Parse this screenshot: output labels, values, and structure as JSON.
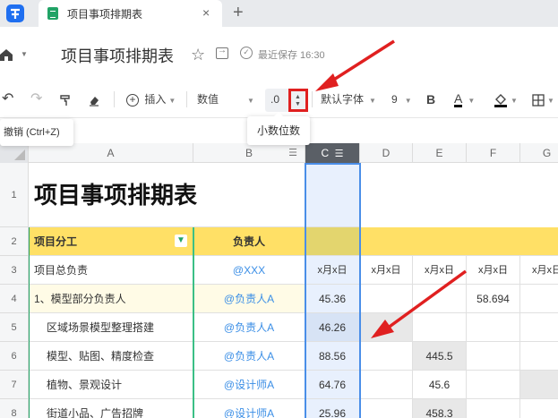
{
  "tabs": {
    "active_title": "项目事项排期表",
    "close": "×",
    "new": "+"
  },
  "header": {
    "doc_title": "项目事项排期表",
    "saved_status": "最近保存 16:30"
  },
  "toolbar": {
    "insert_label": "插入",
    "number_format": "数值",
    "decimal_value": ".0",
    "font_family": "默认字体",
    "font_size": "9",
    "bold": "B",
    "font_color_letter": "A",
    "undo_tooltip": "撤销 (Ctrl+Z)",
    "decimal_tooltip": "小数位数"
  },
  "columns": [
    "A",
    "B",
    "C",
    "D",
    "E",
    "F",
    "G"
  ],
  "rows": [
    "1",
    "2",
    "3",
    "4",
    "5",
    "6",
    "7",
    "8"
  ],
  "sheet": {
    "title": "项目事项排期表",
    "header_a": "项目分工",
    "header_b": "负责人",
    "date_placeholder": "x月x日",
    "r3": {
      "a": "项目总负责",
      "b": "@XXX"
    },
    "r4": {
      "a": "1、模型部分负责人",
      "b": "@负责人A",
      "c": "45.36",
      "f": "58.694"
    },
    "r5": {
      "a": "区域场景模型整理搭建",
      "b": "@负责人A",
      "c": "46.26"
    },
    "r6": {
      "a": "模型、贴图、精度检查",
      "b": "@负责人A",
      "c": "88.56",
      "e": "445.5"
    },
    "r7": {
      "a": "植物、景观设计",
      "b": "@设计师A",
      "c": "64.76",
      "e": "45.6"
    },
    "r8": {
      "a": "街道小品、广告招牌",
      "b": "@设计师A",
      "c": "25.96",
      "e": "458.3"
    }
  },
  "colors": {
    "accent_green": "#21a366",
    "header_yellow": "#ffe066",
    "selected_col": "#e8f0fd",
    "annotation_red": "#e02020",
    "mention_blue": "#3a8ee6"
  }
}
